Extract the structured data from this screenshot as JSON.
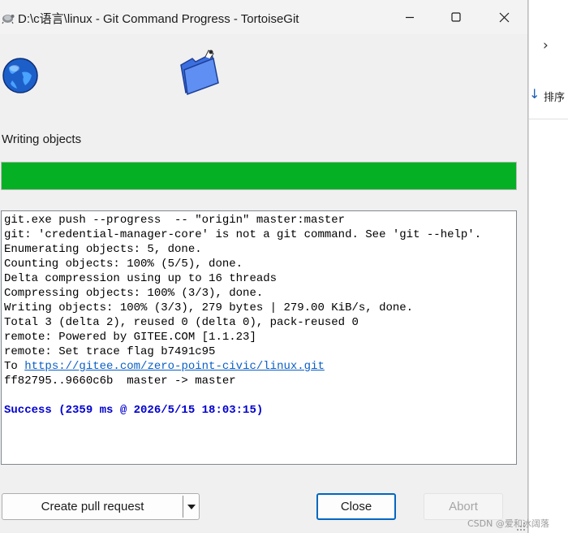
{
  "window": {
    "title": "D:\\c语言\\linux - Git Command Progress - TortoiseGit"
  },
  "background_window": {
    "chevron": "›",
    "sort_label": "排序"
  },
  "status": {
    "text": "Writing objects",
    "progress_percent": 100,
    "progress_color": "#06b025"
  },
  "log": {
    "lines": [
      "git.exe push --progress  -- \"origin\" master:master",
      "git: 'credential-manager-core' is not a git command. See 'git --help'.",
      "Enumerating objects: 5, done.",
      "Counting objects: 100% (5/5), done.",
      "Delta compression using up to 16 threads",
      "Compressing objects: 100% (3/3), done.",
      "Writing objects: 100% (3/3), 279 bytes | 279.00 KiB/s, done.",
      "Total 3 (delta 2), reused 0 (delta 0), pack-reused 0",
      "remote: Powered by GITEE.COM [1.1.23]",
      "remote: Set trace flag b7491c95"
    ],
    "to_prefix": "To ",
    "to_url": "https://gitee.com/zero-point-civic/linux.git",
    "ref_line": "ff82795..9660c6b  master -> master",
    "success": "Success (2359 ms @ 2026/5/15 18:03:15)",
    "success_color": "#0000d0"
  },
  "buttons": {
    "create_pull_request": "Create pull request",
    "close": "Close",
    "abort": "Abort"
  },
  "watermark": "CSDN @爱和冰阔落"
}
